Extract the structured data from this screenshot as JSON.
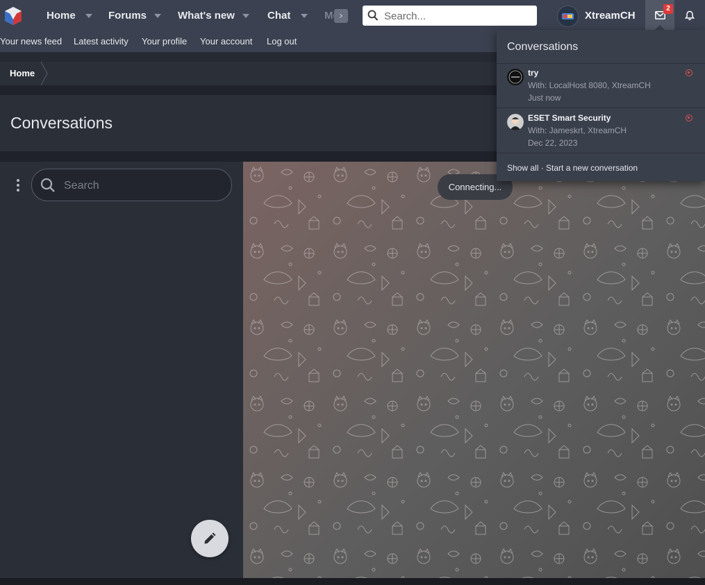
{
  "nav": {
    "items": [
      {
        "label": "Home"
      },
      {
        "label": "Forums"
      },
      {
        "label": "What's new"
      },
      {
        "label": "Chat"
      },
      {
        "label": "Me"
      }
    ],
    "search_placeholder": "Search...",
    "username": "XtreamCH",
    "inbox_badge": "2"
  },
  "subnav": {
    "items": [
      "Your news feed",
      "Latest activity",
      "Your profile",
      "Your account",
      "Log out"
    ]
  },
  "breadcrumb": {
    "home": "Home"
  },
  "page": {
    "title": "Conversations"
  },
  "sidebar": {
    "search_placeholder": "Search"
  },
  "chat": {
    "status": "Connecting..."
  },
  "dropdown": {
    "title": "Conversations",
    "conversations": [
      {
        "title": "try",
        "with": "With: LocalHost 8080, XtreamCH",
        "time": "Just now"
      },
      {
        "title": "ESET Smart Security",
        "with": "With: Jameskrt, XtreamCH",
        "time": "Dec 22, 2023"
      }
    ],
    "show_all": "Show all",
    "separator": " · ",
    "start_new": "Start a new conversation"
  },
  "colors": {
    "nav_bg": "#3b4150",
    "unread": "#d9534f",
    "badge": "#e03a3a"
  }
}
